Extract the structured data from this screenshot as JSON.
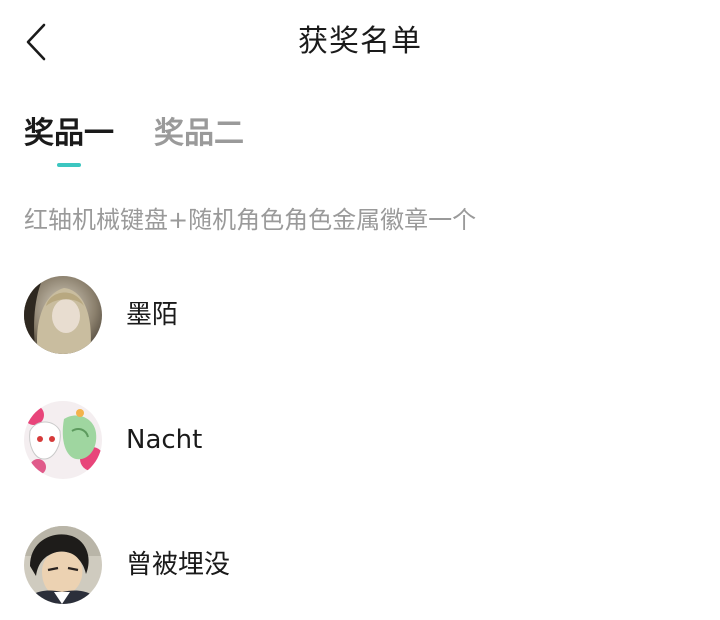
{
  "header": {
    "title": "获奖名单",
    "back_icon": "chevron-left-icon"
  },
  "tabs": [
    {
      "label": "奖品一",
      "active": true
    },
    {
      "label": "奖品二",
      "active": false
    }
  ],
  "colors": {
    "accent": "#3cc6c0",
    "text_primary": "#1a1a1a",
    "text_secondary": "#9a9a9a"
  },
  "prize": {
    "description": "红轴机械键盘+随机角色角色金属徽章一个"
  },
  "winners": [
    {
      "name": "墨陌"
    },
    {
      "name": "Nacht"
    },
    {
      "name": "曾被埋没"
    }
  ]
}
